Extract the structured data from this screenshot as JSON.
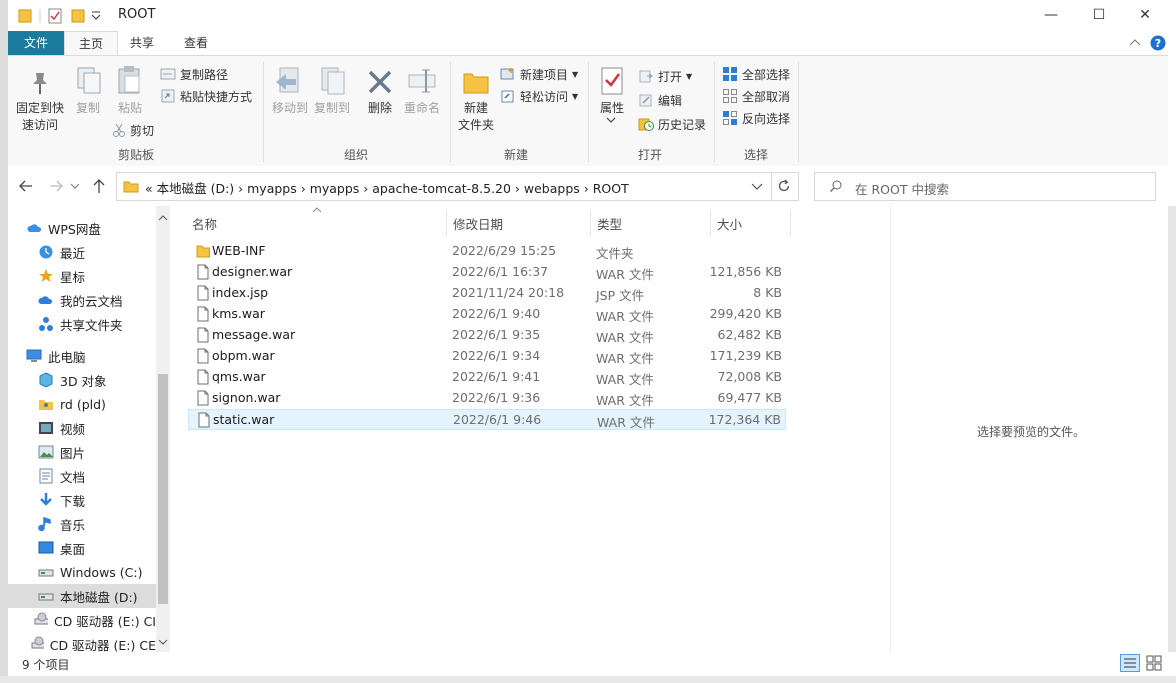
{
  "window": {
    "title": "ROOT"
  },
  "titlebar_buttons": {
    "minimize": "—",
    "maximize": "☐",
    "close": "✕"
  },
  "tabs": [
    "文件",
    "主页",
    "共享",
    "查看"
  ],
  "ribbon": {
    "clipboard": {
      "pin_label": "固定到快\n速访问",
      "copy_label": "复制",
      "paste_label": "粘贴",
      "copy_path": "复制路径",
      "paste_shortcut": "粘贴快捷方式",
      "cut": "剪切",
      "group": "剪贴板"
    },
    "organize": {
      "move_to": "移动到",
      "copy_to": "复制到",
      "delete": "删除",
      "rename": "重命名",
      "group": "组织"
    },
    "new": {
      "new_folder": "新建\n文件夹",
      "new_item": "新建项目",
      "easy_access": "轻松访问",
      "group": "新建"
    },
    "open": {
      "properties": "属性",
      "open": "打开",
      "edit": "编辑",
      "history": "历史记录",
      "group": "打开"
    },
    "select": {
      "select_all": "全部选择",
      "select_none": "全部取消",
      "invert": "反向选择",
      "group": "选择"
    }
  },
  "address": {
    "crumbs": "«  本地磁盘 (D:)   ›   myapps   ›   myapps   ›   apache-tomcat-8.5.20   ›   webapps   ›   ROOT",
    "search_placeholder": "在 ROOT 中搜索"
  },
  "nav": {
    "items": [
      {
        "label": "WPS网盘",
        "icon": "cloud-icon"
      },
      {
        "label": "最近",
        "icon": "clock-icon"
      },
      {
        "label": "星标",
        "icon": "star-icon"
      },
      {
        "label": "我的云文档",
        "icon": "cloud-doc-icon"
      },
      {
        "label": "共享文件夹",
        "icon": "share-icon"
      },
      {
        "label": "此电脑",
        "icon": "computer-icon"
      },
      {
        "label": "3D 对象",
        "icon": "cube-icon"
      },
      {
        "label": "rd (pld)",
        "icon": "user-folder-icon"
      },
      {
        "label": "视频",
        "icon": "video-icon"
      },
      {
        "label": "图片",
        "icon": "picture-icon"
      },
      {
        "label": "文档",
        "icon": "document-icon"
      },
      {
        "label": "下载",
        "icon": "download-icon"
      },
      {
        "label": "音乐",
        "icon": "music-icon"
      },
      {
        "label": "桌面",
        "icon": "desktop-icon"
      },
      {
        "label": "Windows (C:)",
        "icon": "drive-icon"
      },
      {
        "label": "本地磁盘 (D:)",
        "icon": "drive-icon"
      },
      {
        "label": "CD 驱动器 (E:) CI",
        "icon": "cd-icon"
      },
      {
        "label": "CD 驱动器 (E:) CE",
        "icon": "cd-icon"
      }
    ]
  },
  "columns": {
    "name": "名称",
    "date": "修改日期",
    "type": "类型",
    "size": "大小"
  },
  "files": [
    {
      "name": "WEB-INF",
      "date": "2022/6/29 15:25",
      "type": "文件夹",
      "size": "",
      "kind": "folder"
    },
    {
      "name": "designer.war",
      "date": "2022/6/1 16:37",
      "type": "WAR 文件",
      "size": "121,856 KB",
      "kind": "file"
    },
    {
      "name": "index.jsp",
      "date": "2021/11/24 20:18",
      "type": "JSP 文件",
      "size": "8 KB",
      "kind": "file"
    },
    {
      "name": "kms.war",
      "date": "2022/6/1 9:40",
      "type": "WAR 文件",
      "size": "299,420 KB",
      "kind": "file"
    },
    {
      "name": "message.war",
      "date": "2022/6/1 9:35",
      "type": "WAR 文件",
      "size": "62,482 KB",
      "kind": "file"
    },
    {
      "name": "obpm.war",
      "date": "2022/6/1 9:34",
      "type": "WAR 文件",
      "size": "171,239 KB",
      "kind": "file"
    },
    {
      "name": "qms.war",
      "date": "2022/6/1 9:41",
      "type": "WAR 文件",
      "size": "72,008 KB",
      "kind": "file"
    },
    {
      "name": "signon.war",
      "date": "2022/6/1 9:36",
      "type": "WAR 文件",
      "size": "69,477 KB",
      "kind": "file"
    },
    {
      "name": "static.war",
      "date": "2022/6/1 9:46",
      "type": "WAR 文件",
      "size": "172,364 KB",
      "kind": "file",
      "selected": true
    }
  ],
  "preview": {
    "message": "选择要预览的文件。"
  },
  "status": {
    "count": "9 个项目"
  },
  "colors": {
    "file_tab": "#1a7b9c",
    "selection": "#e5f3ff",
    "accent": "#0078d7"
  }
}
